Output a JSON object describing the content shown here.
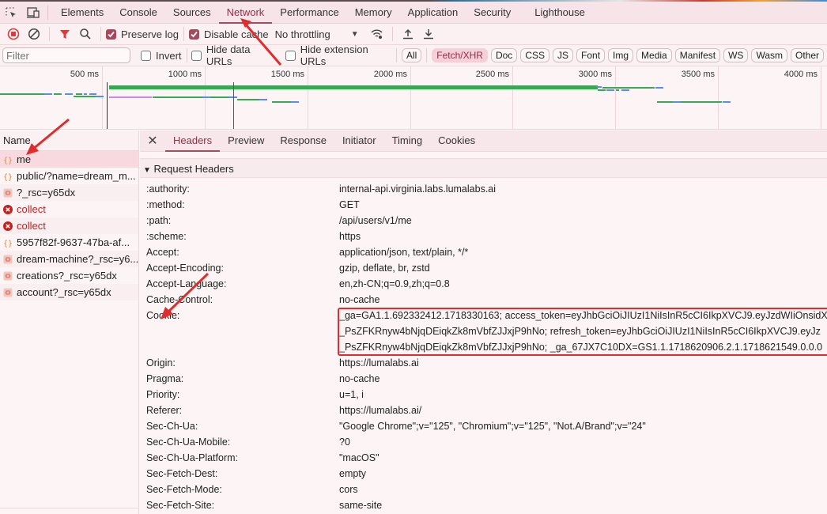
{
  "devtools": {
    "panel_tabs": [
      "Elements",
      "Console",
      "Sources",
      "Network",
      "Performance",
      "Memory",
      "Application",
      "Security",
      "Lighthouse"
    ],
    "active_panel": "Network",
    "icons": {
      "inspect": "inspect-element-icon",
      "device": "device-toolbar-icon"
    }
  },
  "toolbar": {
    "record": "record-stop-icon",
    "clear": "clear-icon",
    "filter": "filter-icon",
    "search": "search-icon",
    "preserve_log": {
      "label": "Preserve log",
      "checked": true
    },
    "disable_cache": {
      "label": "Disable cache",
      "checked": true
    },
    "throttling": "No throttling",
    "network_conditions": "network-conditions-icon",
    "import": "upload-icon",
    "export": "download-icon"
  },
  "filterbar": {
    "placeholder": "Filter",
    "invert": {
      "label": "Invert",
      "checked": false
    },
    "hide_data_urls": {
      "label": "Hide data URLs",
      "checked": false
    },
    "hide_extension_urls": {
      "label": "Hide extension URLs",
      "checked": false
    },
    "types": [
      "All",
      "Fetch/XHR",
      "Doc",
      "CSS",
      "JS",
      "Font",
      "Img",
      "Media",
      "Manifest",
      "WS",
      "Wasm",
      "Other"
    ],
    "active_type": "Fetch/XHR"
  },
  "timeline": {
    "ticks": [
      "500 ms",
      "1000 ms",
      "1500 ms",
      "2000 ms",
      "2500 ms",
      "3000 ms",
      "3500 ms",
      "4000 ms"
    ]
  },
  "requests": {
    "header": "Name",
    "items": [
      {
        "name": "me",
        "type": "fetch",
        "status": "ok",
        "selected": true
      },
      {
        "name": "public/?name=dream_m...",
        "type": "fetch",
        "status": "ok"
      },
      {
        "name": "?_rsc=y65dx",
        "type": "doc",
        "status": "ok"
      },
      {
        "name": "collect",
        "type": "error",
        "status": "error"
      },
      {
        "name": "collect",
        "type": "error",
        "status": "error"
      },
      {
        "name": "5957f82f-9637-47ba-af...",
        "type": "fetch",
        "status": "ok"
      },
      {
        "name": "dream-machine?_rsc=y6...",
        "type": "doc",
        "status": "ok"
      },
      {
        "name": "creations?_rsc=y65dx",
        "type": "doc",
        "status": "ok"
      },
      {
        "name": "account?_rsc=y65dx",
        "type": "doc",
        "status": "ok"
      }
    ]
  },
  "details": {
    "close": "close-icon",
    "tabs": [
      "Headers",
      "Preview",
      "Response",
      "Initiator",
      "Timing",
      "Cookies"
    ],
    "active_tab": "Headers",
    "section_title": "Request Headers",
    "headers": [
      {
        "key": ":authority:",
        "value": "internal-api.virginia.labs.lumalabs.ai"
      },
      {
        "key": ":method:",
        "value": "GET"
      },
      {
        "key": ":path:",
        "value": "/api/users/v1/me"
      },
      {
        "key": ":scheme:",
        "value": "https"
      },
      {
        "key": "Accept:",
        "value": "application/json, text/plain, */*"
      },
      {
        "key": "Accept-Encoding:",
        "value": "gzip, deflate, br, zstd"
      },
      {
        "key": "Accept-Language:",
        "value": "en,zh-CN;q=0.9,zh;q=0.8"
      },
      {
        "key": "Cache-Control:",
        "value": "no-cache"
      }
    ],
    "cookie": {
      "key": "Cookie:",
      "lines": [
        "_ga=GA1.1.692332412.1718330163; access_token=eyJhbGciOiJIUzI1NiIsInR5cCI6IkpXVCJ9.eyJzdWIiOnsidX",
        "_PsZFKRnyw4bNjqDEiqkZk8mVbfZJJxjP9hNo; refresh_token=eyJhbGciOiJIUzI1NiIsInR5cCI6IkpXVCJ9.eyJz",
        "_PsZFKRnyw4bNjqDEiqkZk8mVbfZJJxjP9hNo; _ga_67JX7C10DX=GS1.1.1718620906.2.1.1718621549.0.0.0"
      ]
    },
    "headers_after": [
      {
        "key": "Origin:",
        "value": "https://lumalabs.ai"
      },
      {
        "key": "Pragma:",
        "value": "no-cache"
      },
      {
        "key": "Priority:",
        "value": "u=1, i"
      },
      {
        "key": "Referer:",
        "value": "https://lumalabs.ai/"
      },
      {
        "key": "Sec-Ch-Ua:",
        "value": "\"Google Chrome\";v=\"125\", \"Chromium\";v=\"125\", \"Not.A/Brand\";v=\"24\""
      },
      {
        "key": "Sec-Ch-Ua-Mobile:",
        "value": "?0"
      },
      {
        "key": "Sec-Ch-Ua-Platform:",
        "value": "\"macOS\""
      },
      {
        "key": "Sec-Fetch-Dest:",
        "value": "empty"
      },
      {
        "key": "Sec-Fetch-Mode:",
        "value": "cors"
      },
      {
        "key": "Sec-Fetch-Site:",
        "value": "same-site"
      }
    ]
  },
  "colors": {
    "accent": "#a24d61",
    "annotation": "#e02c2c",
    "error": "#c5221f",
    "timeline_green": "#3aa757",
    "timeline_blue": "#5b8def",
    "timeline_purple": "#c88ce8"
  }
}
